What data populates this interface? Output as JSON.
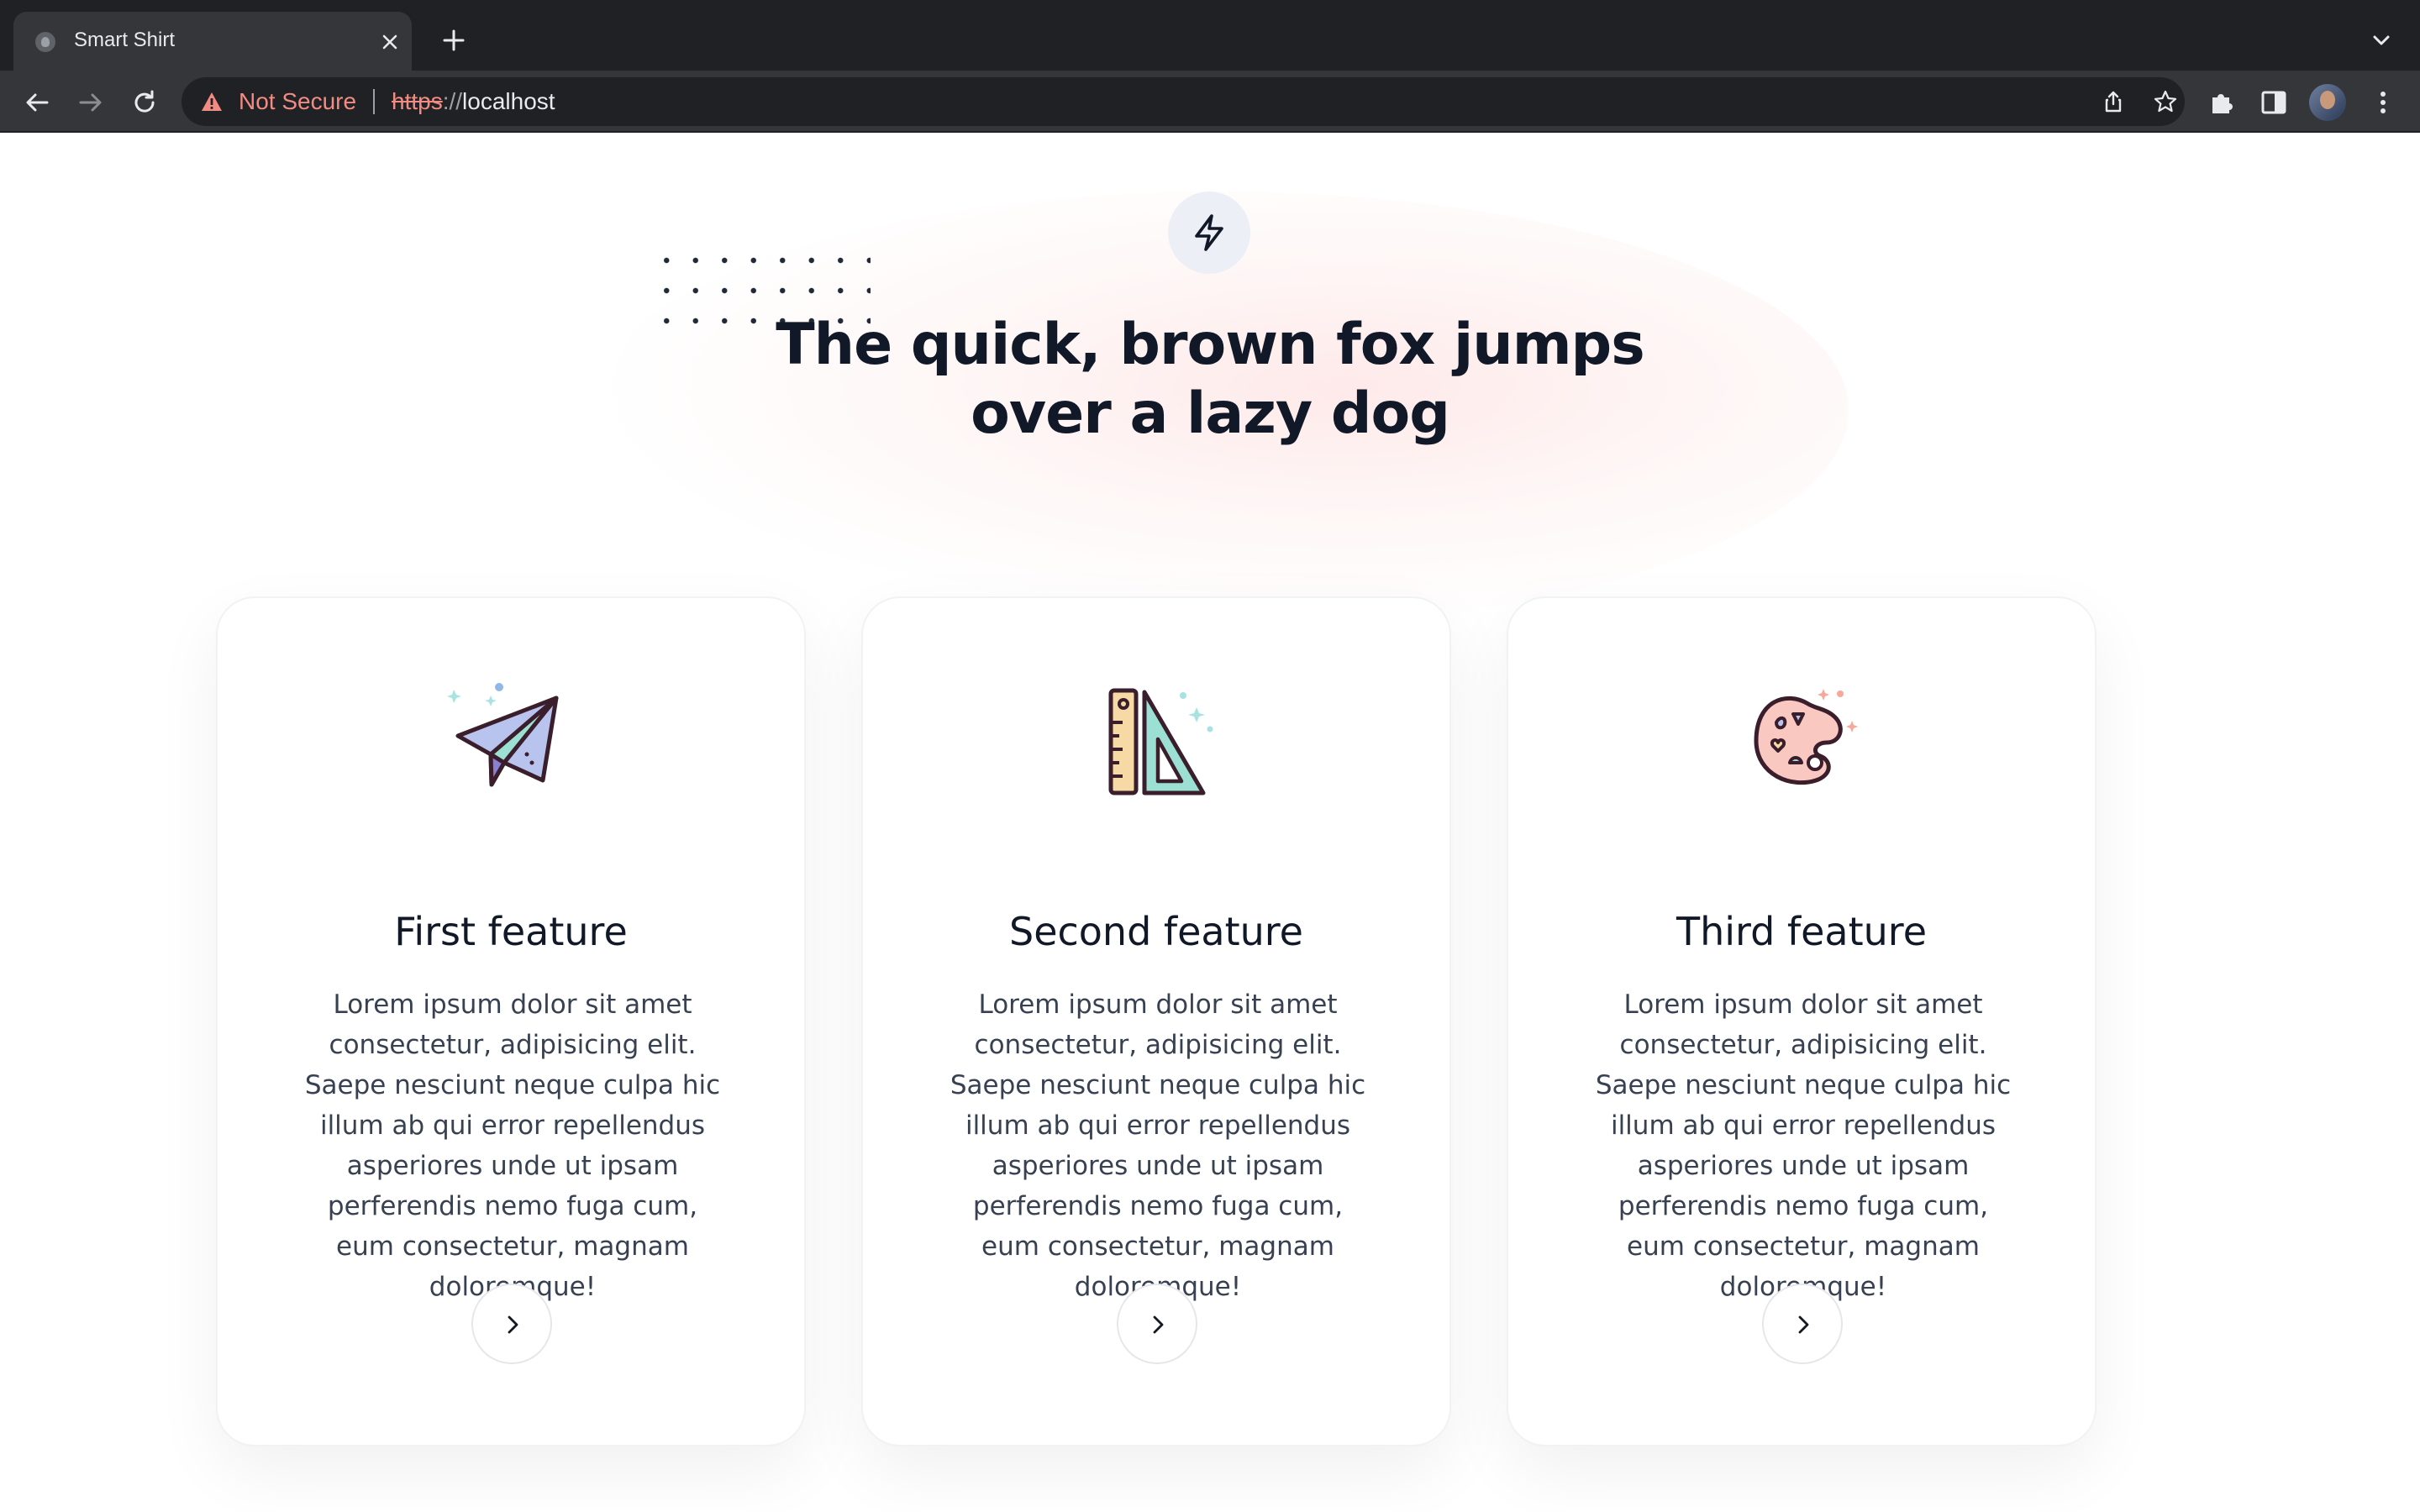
{
  "browser": {
    "tab": {
      "title": "Smart Shirt",
      "favicon": "spider-favicon-icon",
      "close_icon": "close-icon"
    },
    "new_tab_icon": "plus-icon",
    "tab_search_icon": "chevron-down-icon",
    "nav": {
      "back_icon": "arrow-left-icon",
      "forward_icon": "arrow-right-icon",
      "reload_icon": "reload-icon"
    },
    "omnibox": {
      "warning_icon": "warning-triangle-icon",
      "security_label": "Not Secure",
      "url_scheme": "https",
      "url_separator": "://",
      "url_host": "localhost",
      "share_icon": "share-icon",
      "bookmark_icon": "star-icon"
    },
    "toolbar_icons": [
      "puzzle-extensions-icon",
      "side-panel-icon",
      "profile-avatar",
      "kebab-menu-icon"
    ]
  },
  "hero": {
    "badge_icon": "lightning-bolt-icon",
    "headline_line1": "The quick, brown fox jumps",
    "headline_line2": "over a lazy dog"
  },
  "features": [
    {
      "illustration": "paper-plane-icon",
      "title": "First feature",
      "text": "Lorem ipsum dolor sit amet consectetur, adipisicing elit. Saepe nesciunt neque culpa hic illum ab qui error repellendus asperiores unde ut ipsam perferendis nemo fuga cum, eum consectetur, magnam doloremque!",
      "button_icon": "chevron-right-icon"
    },
    {
      "illustration": "ruler-set-square-icon",
      "title": "Second feature",
      "text": "Lorem ipsum dolor sit amet consectetur, adipisicing elit. Saepe nesciunt neque culpa hic illum ab qui error repellendus asperiores unde ut ipsam perferendis nemo fuga cum, eum consectetur, magnam doloremque!",
      "button_icon": "chevron-right-icon"
    },
    {
      "illustration": "paint-palette-icon",
      "title": "Third feature",
      "text": "Lorem ipsum dolor sit amet consectetur, adipisicing elit. Saepe nesciunt neque culpa hic illum ab qui error repellendus asperiores unde ut ipsam perferendis nemo fuga cum, eum consectetur, magnam doloremque!",
      "button_icon": "chevron-right-icon"
    }
  ],
  "colors": {
    "chrome_dark": "#202124",
    "chrome_toolbar": "#35363a",
    "not_secure": "#f28b82",
    "heading": "#111827",
    "body_text": "#374151",
    "glow": "#fde2e2",
    "badge_bg": "#eceff6"
  }
}
